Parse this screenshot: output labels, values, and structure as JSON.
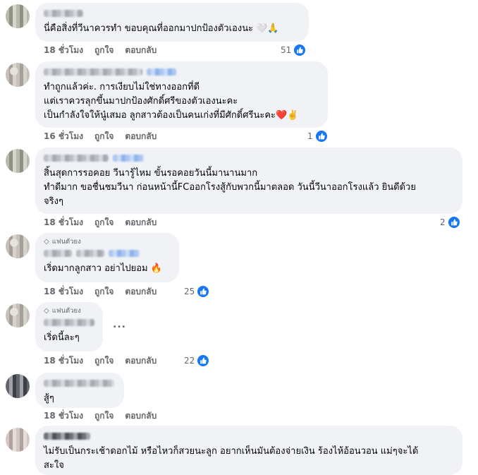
{
  "comments": [
    {
      "id": "c1",
      "fan_badge": "",
      "text": "นี่คือสิ่งที่วีนาควรทำ ขอบคุณที่ออกมาปกป้องตัวเองนะ 🤍🙏",
      "time": "18 ชั่วโมง",
      "like_label": "ถูกใจ",
      "reply_label": "ตอบกลับ",
      "likes": "51"
    },
    {
      "id": "c2",
      "fan_badge": "",
      "text": "ทำถูกแล้วค่ะ. การเงียบไม่ใช่ทางออกที่ดี\nแต่เราควรลุกขึ้นมาปกป้องศักดิ์ศรีของตัวเองนะคะ\nเป็นกำลังใจให้นู๋เสมอ ลูกสาวต้องเป็นคนเก่งที่มีศักดิ์ศรีนะคะ❤️✌️",
      "time": "16 ชั่วโมง",
      "like_label": "ถูกใจ",
      "reply_label": "ตอบกลับ",
      "likes": "1"
    },
    {
      "id": "c3",
      "fan_badge": "",
      "text": "สิ้นสุดการรอคอย วีนารู้ไหม ขั้นรอคอยวันนี้มานานมาก\nทำดีมาก ขอชื่นชมวีนา ก่อนหน้านี้FCออกโรงสู้กับพวกนี้มาตลอด วันนี้วีนาออกโรงแล้ว ยินดีด้วย\nจริงๆ",
      "time": "18 ชั่วโมง",
      "like_label": "ถูกใจ",
      "reply_label": "ตอบกลับ",
      "likes": "2"
    },
    {
      "id": "c4",
      "fan_badge": "แฟนตัวยง",
      "text": "เริ่ดมากลูกสาว อย่าไปยอม 🔥",
      "time": "18 ชั่วโมง",
      "like_label": "ถูกใจ",
      "reply_label": "ตอบกลับ",
      "likes": "25"
    },
    {
      "id": "c5",
      "fan_badge": "แฟนตัวยง",
      "text": "เริ่ดนี้ละๆ",
      "time": "18 ชั่วโมง",
      "like_label": "ถูกใจ",
      "reply_label": "ตอบกลับ",
      "likes": "22",
      "more": "..."
    },
    {
      "id": "c6",
      "fan_badge": "",
      "text": "สู้ๆ",
      "time": "18 ชั่วโมง",
      "like_label": "ถูกใจ",
      "reply_label": "ตอบกลับ",
      "likes": ""
    },
    {
      "id": "c7",
      "fan_badge": "",
      "text": "ไม่รับเป็นกระเช้าดอกไม้ หรือไหวก็สวยนะลูก อยากเห็นมันต้องจ่ายเงิน ร้องไห้อ้อนวอน แม่ๆจะได้\nสะใจ",
      "time": "",
      "like_label": "",
      "reply_label": "",
      "likes": ""
    }
  ],
  "colors": {
    "bubble_bg": "#f0f2f5",
    "meta_text": "#65676b",
    "like_blue": "#1877f2"
  },
  "icons": {
    "like": "thumbs-up-icon",
    "fan_badge": "diamond-icon",
    "more": "more-icon"
  }
}
